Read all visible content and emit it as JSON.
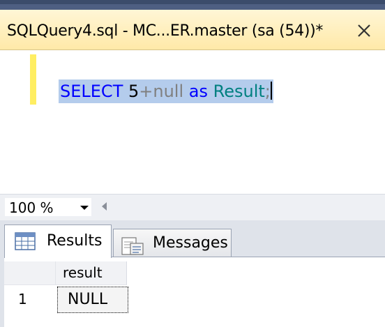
{
  "document_tab": {
    "title": "SQLQuery4.sql - MC...ER.master (sa (54))*",
    "close_icon": "close-icon"
  },
  "editor": {
    "tokens": {
      "select": "SELECT ",
      "five": "5",
      "plus": "+",
      "null_kw": "null ",
      "as_kw": "as ",
      "result_id": "Result",
      "semicolon": ";"
    }
  },
  "zoom": {
    "value": "100 %",
    "dropdown_icon": "chevron-down-icon",
    "scroll_icon": "scroll-left-icon"
  },
  "results_tabs": [
    {
      "label": "Results",
      "icon": "grid-icon",
      "active": true
    },
    {
      "label": "Messages",
      "icon": "messages-icon",
      "active": false
    }
  ],
  "grid": {
    "columns": [
      "result"
    ],
    "rows": [
      {
        "row_number": "1",
        "cells": [
          "NULL"
        ]
      }
    ]
  },
  "colors": {
    "keyword": "#0000ff",
    "operator": "#808080",
    "identifier": "#008080",
    "selection": "#b4ccec",
    "tab_background": "#ffe9a8",
    "change_bar": "#ffee62"
  }
}
